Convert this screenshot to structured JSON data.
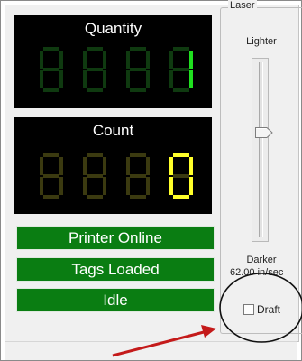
{
  "quantity": {
    "title": "Quantity",
    "digits": [
      "",
      "",
      "",
      "1"
    ],
    "lit_color": "#1fe01f",
    "dim_color": "#0f3a10"
  },
  "count": {
    "title": "Count",
    "digits": [
      "",
      "",
      "",
      "0"
    ],
    "lit_color": "#ffff2a",
    "dim_color": "#3b3a10"
  },
  "status": {
    "printer": "Printer Online",
    "tags": "Tags Loaded",
    "idle": "Idle",
    "color": "#0a7d12"
  },
  "laser": {
    "legend": "Laser",
    "lighter": "Lighter",
    "darker": "Darker",
    "speed": "62.00 in/sec",
    "draft_label": "Draft",
    "draft_checked": false
  },
  "annotation": {
    "arrow_color": "#c41a1a",
    "circle_color": "#111111"
  }
}
